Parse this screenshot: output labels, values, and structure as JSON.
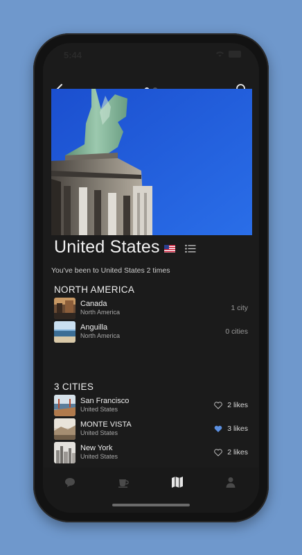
{
  "status": {
    "time": "5:44"
  },
  "nav": {
    "page_dots": 2,
    "active_dot": 0
  },
  "country": {
    "name": "United States",
    "subtitle": "You've been to United States 2 times"
  },
  "region": {
    "header": "NORTH AMERICA",
    "items": [
      {
        "name": "Canada",
        "region": "North America",
        "count": "1 city"
      },
      {
        "name": "Anguilla",
        "region": "North America",
        "count": "0 cities"
      }
    ]
  },
  "cities": {
    "header": "3 CITIES",
    "items": [
      {
        "name": "San Francisco",
        "country": "United States",
        "likes": "2 likes",
        "liked": false
      },
      {
        "name": "MONTE VISTA",
        "country": "United States",
        "likes": "3 likes",
        "liked": true
      },
      {
        "name": "New York",
        "country": "United States",
        "likes": "2 likes",
        "liked": false
      }
    ]
  },
  "tabs": [
    {
      "icon": "chat-bubble-icon",
      "active": false
    },
    {
      "icon": "coffee-cup-icon",
      "active": false
    },
    {
      "icon": "map-icon",
      "active": true
    },
    {
      "icon": "profile-icon",
      "active": false
    }
  ],
  "colors": {
    "background": "#6f98cc",
    "screen": "#1b1b1b",
    "heart_active": "#5b8fe0"
  }
}
